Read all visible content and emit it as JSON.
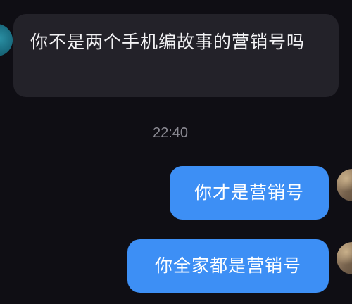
{
  "messages": [
    {
      "direction": "incoming",
      "text": "你不是两个手机编故事的营销号吗"
    },
    {
      "direction": "outgoing",
      "text": "你才是营销号"
    },
    {
      "direction": "outgoing",
      "text": "你全家都是营销号"
    }
  ],
  "timestamp": "22:40",
  "colors": {
    "background": "#0f0e14",
    "incoming_bubble": "#232229",
    "outgoing_bubble": "#3d8ff5",
    "timestamp_text": "#8b8a93"
  }
}
